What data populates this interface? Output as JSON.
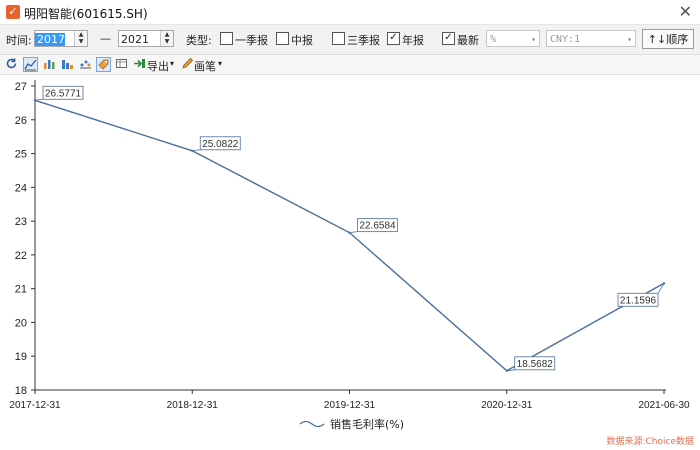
{
  "window": {
    "title": "明阳智能(601615.SH)",
    "close_glyph": "✕"
  },
  "filters": {
    "time_label": "时间:",
    "start_year": "2017",
    "dash": "—",
    "end_year": "2021",
    "type_label": "类型:",
    "checkboxes": [
      {
        "label": "一季报",
        "checked": false
      },
      {
        "label": "中报",
        "checked": false
      },
      {
        "label": "三季报",
        "checked": false
      },
      {
        "label": "年报",
        "checked": true
      },
      {
        "label": "最新",
        "checked": true
      }
    ],
    "unit_select": "%",
    "currency_select": "CNY:1",
    "sort_button": "↑↓顺序"
  },
  "toolbar": {
    "icons": [
      "refresh-icon",
      "line-chart-icon",
      "bar-chart-icon",
      "stacked-bar-icon",
      "scatter-icon",
      "tag-icon",
      "table-icon"
    ],
    "export_label": "导出",
    "draw_label": "画笔"
  },
  "chart_data": {
    "type": "line",
    "x": [
      "2017-12-31",
      "2018-12-31",
      "2019-12-31",
      "2020-12-31",
      "2021-06-30"
    ],
    "series": [
      {
        "name": "销售毛利率(%)",
        "values": [
          26.5771,
          25.0822,
          22.6584,
          18.5682,
          21.1596
        ],
        "color": "#4a6f9b"
      }
    ],
    "data_labels": [
      "26.5771",
      "25.0822",
      "22.6584",
      "18.5682",
      "21.1596"
    ],
    "y_ticks": [
      18,
      19,
      20,
      21,
      22,
      23,
      24,
      25,
      26,
      27
    ],
    "ylim": [
      18,
      27
    ],
    "legend_position": "bottom-center",
    "grid": false
  },
  "footer": {
    "source": "数据来源:Choice数据"
  }
}
